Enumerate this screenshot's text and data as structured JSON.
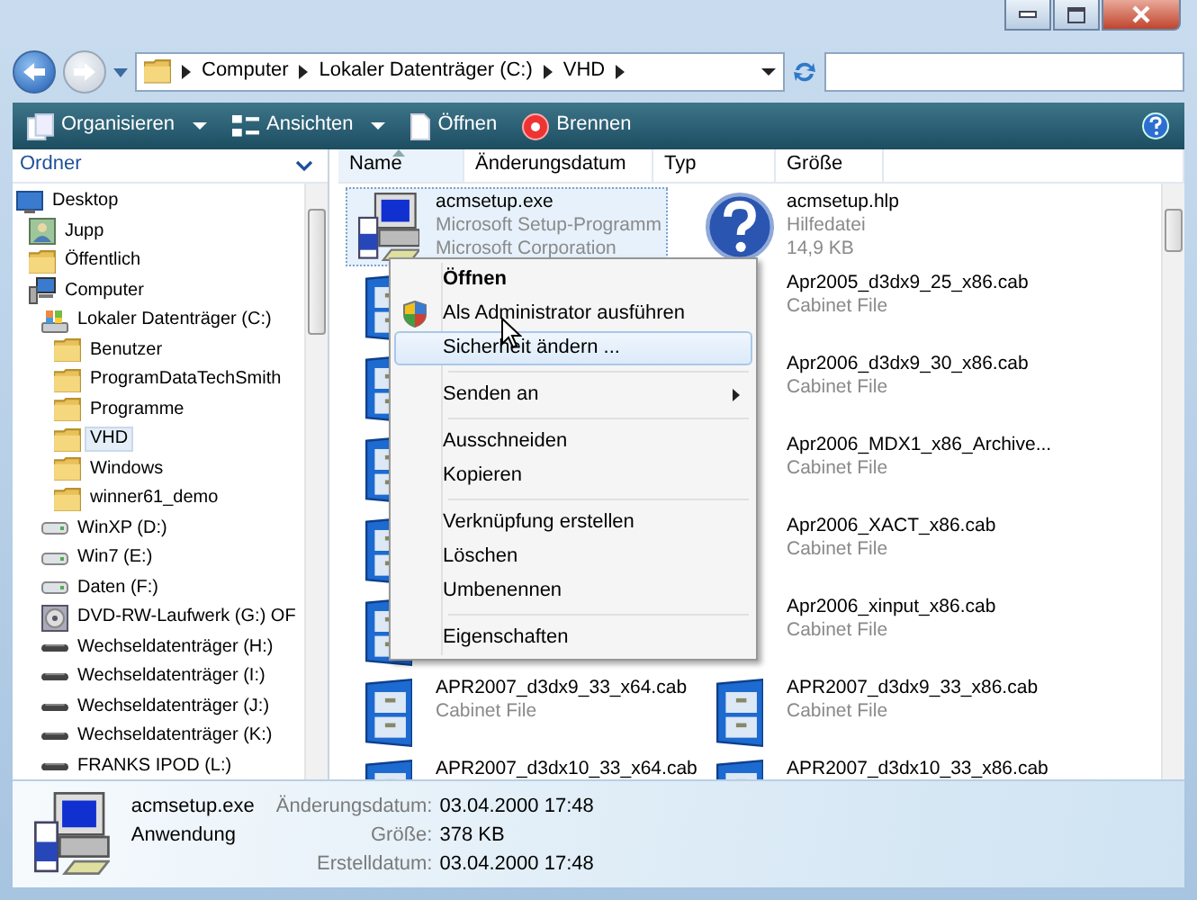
{
  "address": {
    "crumbs": [
      "Computer",
      "Lokaler Datenträger (C:)",
      "VHD"
    ]
  },
  "toolbar": [
    {
      "label": "Organisieren",
      "dropdown": true,
      "kind": "pages"
    },
    {
      "label": "Ansichten",
      "dropdown": true,
      "kind": "views"
    },
    {
      "label": "Öffnen",
      "dropdown": false,
      "kind": "page"
    },
    {
      "label": "Brennen",
      "dropdown": false,
      "kind": "disc"
    }
  ],
  "folders_pane": {
    "title": "Ordner",
    "tree": [
      {
        "label": "Desktop",
        "kind": "desktop",
        "selected": false,
        "children": [
          {
            "label": "Jupp",
            "kind": "user",
            "selected": false
          },
          {
            "label": "Öffentlich",
            "kind": "folder",
            "selected": false
          },
          {
            "label": "Computer",
            "kind": "computer",
            "selected": false,
            "children": [
              {
                "label": "Lokaler Datenträger (C:)",
                "kind": "system-drive",
                "selected": false,
                "children": [
                  {
                    "label": "Benutzer",
                    "kind": "folder",
                    "selected": false
                  },
                  {
                    "label": "ProgramDataTechSmith",
                    "kind": "folder",
                    "selected": false
                  },
                  {
                    "label": "Programme",
                    "kind": "folder",
                    "selected": false
                  },
                  {
                    "label": "VHD",
                    "kind": "folder",
                    "selected": true
                  },
                  {
                    "label": "Windows",
                    "kind": "folder",
                    "selected": false
                  },
                  {
                    "label": "winner61_demo",
                    "kind": "folder",
                    "selected": false
                  }
                ]
              },
              {
                "label": "WinXP (D:)",
                "kind": "drive",
                "selected": false
              },
              {
                "label": "Win7 (E:)",
                "kind": "drive",
                "selected": false
              },
              {
                "label": "Daten (F:)",
                "kind": "drive",
                "selected": false
              },
              {
                "label": "DVD-RW-Laufwerk (G:) OF",
                "kind": "dvd",
                "selected": false
              },
              {
                "label": "Wechseldatenträger (H:)",
                "kind": "removable",
                "selected": false
              },
              {
                "label": "Wechseldatenträger (I:)",
                "kind": "removable",
                "selected": false
              },
              {
                "label": "Wechseldatenträger (J:)",
                "kind": "removable",
                "selected": false
              },
              {
                "label": "Wechseldatenträger (K:)",
                "kind": "removable",
                "selected": false
              },
              {
                "label": "FRANKS IPOD (L:)",
                "kind": "removable",
                "selected": false
              }
            ]
          }
        ]
      }
    ]
  },
  "columns": [
    {
      "label": "Name",
      "sorted": true
    },
    {
      "label": "Änderungsdatum",
      "sorted": false
    },
    {
      "label": "Typ",
      "sorted": false
    },
    {
      "label": "Größe",
      "sorted": false
    }
  ],
  "files": [
    {
      "name": "acmsetup.exe",
      "type": "Microsoft Setup-Programm",
      "detail": "Microsoft Corporation",
      "kind": "setup",
      "selected": true
    },
    {
      "name": "acmsetup.hlp",
      "type": "Hilfedatei",
      "detail": "14,9 KB",
      "kind": "help",
      "selected": false
    },
    {
      "kind": "cabinet",
      "selected": false
    },
    {
      "name": "Apr2005_d3dx9_25_x86.cab",
      "type": "Cabinet File",
      "kind": "covered",
      "selected": false
    },
    {
      "kind": "cabinet",
      "selected": false
    },
    {
      "name": "Apr2006_d3dx9_30_x86.cab",
      "type": "Cabinet File",
      "kind": "covered",
      "selected": false
    },
    {
      "kind": "cabinet",
      "selected": false
    },
    {
      "name": "Apr2006_MDX1_x86_Archive...",
      "type": "Cabinet File",
      "kind": "covered",
      "selected": false
    },
    {
      "kind": "cabinet",
      "selected": false
    },
    {
      "name": "Apr2006_XACT_x86.cab",
      "type": "Cabinet File",
      "kind": "covered",
      "selected": false
    },
    {
      "kind": "cabinet",
      "selected": false
    },
    {
      "name": "Apr2006_xinput_x86.cab",
      "type": "Cabinet File",
      "kind": "covered",
      "selected": false
    },
    {
      "name": "APR2007_d3dx9_33_x64.cab",
      "type": "Cabinet File",
      "kind": "cabinet",
      "selected": false
    },
    {
      "name": "APR2007_d3dx9_33_x86.cab",
      "type": "Cabinet File",
      "kind": "cabinet",
      "selected": false
    },
    {
      "name": "APR2007_d3dx10_33_x64.cab",
      "kind": "cabinet",
      "selected": false
    },
    {
      "name": "APR2007_d3dx10_33_x86.cab",
      "kind": "cabinet",
      "selected": false
    }
  ],
  "context_menu": [
    {
      "kind": "command",
      "label": "Öffnen",
      "bold": true,
      "submenu": false,
      "selected": false
    },
    {
      "kind": "elevated-command",
      "label": "Als Administrator ausführen",
      "bold": false,
      "submenu": false,
      "selected": false
    },
    {
      "kind": "command",
      "label": "Sicherheit ändern ...",
      "bold": false,
      "submenu": false,
      "selected": true
    },
    {
      "kind": "separator"
    },
    {
      "kind": "command",
      "label": "Senden an",
      "bold": false,
      "submenu": true,
      "selected": false
    },
    {
      "kind": "separator"
    },
    {
      "kind": "command",
      "label": "Ausschneiden",
      "bold": false,
      "submenu": false,
      "selected": false
    },
    {
      "kind": "command",
      "label": "Kopieren",
      "bold": false,
      "submenu": false,
      "selected": false
    },
    {
      "kind": "separator"
    },
    {
      "kind": "command",
      "label": "Verknüpfung erstellen",
      "bold": false,
      "submenu": false,
      "selected": false
    },
    {
      "kind": "command",
      "label": "Löschen",
      "bold": false,
      "submenu": false,
      "selected": false
    },
    {
      "kind": "command",
      "label": "Umbenennen",
      "bold": false,
      "submenu": false,
      "selected": false
    },
    {
      "kind": "separator"
    },
    {
      "kind": "command",
      "label": "Eigenschaften",
      "bold": false,
      "submenu": false,
      "selected": false
    }
  ],
  "details": {
    "name": "acmsetup.exe",
    "type": "Anwendung",
    "properties": [
      {
        "label": "Änderungsdatum:",
        "value": "03.04.2000 17:48"
      },
      {
        "label": "Größe:",
        "value": "378 KB"
      },
      {
        "label": "Erstelldatum:",
        "value": "03.04.2000 17:48"
      }
    ]
  }
}
